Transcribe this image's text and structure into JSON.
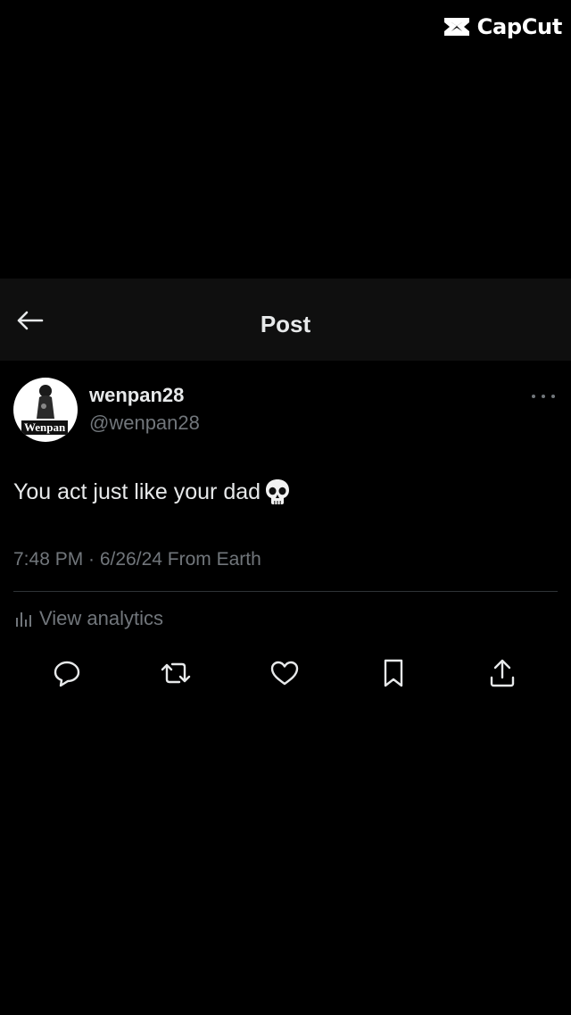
{
  "watermark": {
    "text": "CapCut"
  },
  "header": {
    "title": "Post"
  },
  "post": {
    "display_name": "wenpan28",
    "handle": "@wenpan28",
    "avatar_badge": "Wenpan",
    "text": "You act just like your dad",
    "emoji_icon": "skull-emoji",
    "timestamp": "7:48 PM · 6/26/24 From Earth",
    "analytics_label": "View analytics"
  },
  "actions": [
    {
      "name": "reply-icon"
    },
    {
      "name": "repost-icon"
    },
    {
      "name": "like-icon"
    },
    {
      "name": "bookmark-icon"
    },
    {
      "name": "share-icon"
    }
  ],
  "colors": {
    "background": "#000000",
    "header_background": "#0f0f0f",
    "primary_text": "#e7e9ea",
    "secondary_text": "#71767b",
    "divider": "#2f3336"
  }
}
